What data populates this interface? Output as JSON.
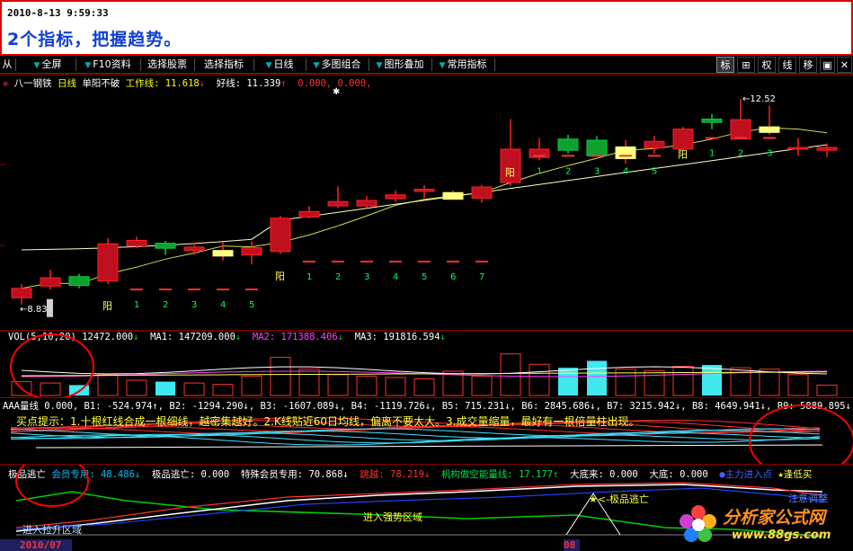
{
  "caption": {
    "timestamp": "2010-8-13 9:59:33",
    "title": "2个指标，把握趋势。"
  },
  "toolbar": {
    "items": [
      {
        "label": "从",
        "arrow": false
      },
      {
        "label": "全屏",
        "arrow": true
      },
      {
        "label": "F10资料",
        "arrow": true
      },
      {
        "label": "选择股票",
        "arrow": false
      },
      {
        "label": "选择指标",
        "arrow": true
      },
      {
        "label": "日线",
        "arrow": true
      },
      {
        "label": "多图组合",
        "arrow": true
      },
      {
        "label": "图形叠加",
        "arrow": true
      },
      {
        "label": "常用指标",
        "arrow": true
      }
    ],
    "right_items": [
      {
        "label": "标",
        "active": true
      },
      {
        "label": "⊞",
        "active": false
      },
      {
        "label": "权",
        "active": false
      },
      {
        "label": "线",
        "active": false
      },
      {
        "label": "移",
        "active": false
      },
      {
        "label": "▣",
        "active": false
      },
      {
        "label": "✕",
        "active": false
      }
    ]
  },
  "main_chart": {
    "stock": "八一钢铁",
    "period": "日线",
    "indicator": "单阳不破",
    "line1_label": "工作线: 11.618",
    "line2_label": "好线: 11.339",
    "extra": "0.000, 0.000,",
    "high_label": "12.52",
    "low_label": "8.83",
    "yang_label": "阳",
    "count_labels_1": [
      "1",
      "2",
      "3",
      "4",
      "5"
    ],
    "count_labels_2": [
      "1",
      "2",
      "3",
      "4",
      "5",
      "6",
      "7"
    ],
    "count_labels_3": [
      "1",
      "2",
      "3",
      "4",
      "5"
    ],
    "count_labels_4": [
      "1",
      "2",
      "3"
    ]
  },
  "vol_pane": {
    "label": "VOL(5,10,20)",
    "vol": "12472.000",
    "ma1": "MA1: 147209.000",
    "ma2": "MA2: 171388.406",
    "ma3": "MA3: 191816.594"
  },
  "aaa_pane": {
    "label": "AAA量线",
    "values": "0.000, B1: -524.974↑, B2: -1294.290↓, B3: -1607.089↓, B4: -1119.726↓, B5: 715.231↓, B6: 2845.686↓, B7: 3215.942↓, B8: 4649.941↓, B9: 5889.895↓, B10: 1",
    "tip": "买点提示：1.十根红线合成一根细线，越密集越好。2.K线贴近60日均线，偏离不要太大。3.成交量缩量，最好有一根倍量柱出现。"
  },
  "escape_pane": {
    "label": "极品逃亡",
    "member": "会员专用: 48.486↓",
    "escape_val": "极品逃亡: 0.000",
    "special": "特殊会员专用: 70.868↓",
    "jump": "跳越: 78.219↓",
    "inst": "机构做空能量线: 17.177↑",
    "big_come": "大底来: 0.000",
    "big_bottom": "大底: 0.000",
    "main_in": "●主力进入点",
    "escape_low": "★逢低买",
    "note_escape": "★<-极品逃亡",
    "note_trend": "进入强势区域",
    "note_lift": "进入拉升区域",
    "note_adjust": "注意调整",
    "date_left": "2010/07",
    "date_right": "08"
  },
  "watermark": {
    "brand": "分析家公式网",
    "url": "www.88gs.com"
  },
  "colors": {
    "up": "#ff2020",
    "down": "#00d040",
    "frame": "#8b0000",
    "cyan": "#00c0c0",
    "yellow": "#ffff60"
  },
  "candles": [
    {
      "o": 8.95,
      "c": 9.12,
      "h": 9.2,
      "l": 8.83
    },
    {
      "o": 9.16,
      "c": 9.31,
      "h": 9.45,
      "l": 9.1
    },
    {
      "o": 9.33,
      "c": 9.17,
      "h": 9.38,
      "l": 9.12
    },
    {
      "o": 9.25,
      "c": 9.92,
      "h": 10.02,
      "l": 9.2
    },
    {
      "o": 9.88,
      "c": 9.98,
      "h": 10.05,
      "l": 9.84
    },
    {
      "o": 9.93,
      "c": 9.84,
      "h": 9.97,
      "l": 9.72
    },
    {
      "o": 9.8,
      "c": 9.86,
      "h": 9.94,
      "l": 9.72
    },
    {
      "o": 9.7,
      "c": 9.8,
      "h": 9.95,
      "l": 9.62
    },
    {
      "o": 9.72,
      "c": 9.85,
      "h": 9.96,
      "l": 9.55
    },
    {
      "o": 9.78,
      "c": 10.38,
      "h": 10.42,
      "l": 9.74
    },
    {
      "o": 10.4,
      "c": 10.5,
      "h": 10.6,
      "l": 10.38
    },
    {
      "o": 10.6,
      "c": 10.68,
      "h": 10.95,
      "l": 10.56
    },
    {
      "o": 10.6,
      "c": 10.7,
      "h": 10.78,
      "l": 10.56
    },
    {
      "o": 10.73,
      "c": 10.8,
      "h": 10.88,
      "l": 10.68
    },
    {
      "o": 10.86,
      "c": 10.9,
      "h": 10.97,
      "l": 10.74
    },
    {
      "o": 10.72,
      "c": 10.84,
      "h": 10.88,
      "l": 10.72
    },
    {
      "o": 10.74,
      "c": 10.94,
      "h": 10.98,
      "l": 10.66
    },
    {
      "o": 11.02,
      "c": 11.62,
      "h": 12.16,
      "l": 10.96
    },
    {
      "o": 11.47,
      "c": 11.62,
      "h": 11.82,
      "l": 11.42
    },
    {
      "o": 11.8,
      "c": 11.6,
      "h": 11.88,
      "l": 11.54
    },
    {
      "o": 11.78,
      "c": 11.5,
      "h": 11.85,
      "l": 11.48
    },
    {
      "o": 11.45,
      "c": 11.66,
      "h": 11.78,
      "l": 11.36
    },
    {
      "o": 11.64,
      "c": 11.76,
      "h": 11.86,
      "l": 11.54
    },
    {
      "o": 11.62,
      "c": 11.98,
      "h": 12.02,
      "l": 11.58
    },
    {
      "o": 12.16,
      "c": 12.1,
      "h": 12.25,
      "l": 11.98
    },
    {
      "o": 11.8,
      "c": 12.15,
      "h": 12.52,
      "l": 11.8
    },
    {
      "o": 11.92,
      "c": 12.02,
      "h": 12.4,
      "l": 11.88
    },
    {
      "o": 11.62,
      "c": 11.65,
      "h": 11.82,
      "l": 11.5
    },
    {
      "o": 11.6,
      "c": 11.65,
      "h": 11.72,
      "l": 11.48
    }
  ],
  "volumes": [
    20,
    18,
    15,
    30,
    22,
    20,
    18,
    16,
    28,
    55,
    38,
    30,
    28,
    26,
    24,
    35,
    28,
    60,
    45,
    40,
    50,
    38,
    36,
    42,
    44,
    40,
    38,
    30,
    15
  ]
}
